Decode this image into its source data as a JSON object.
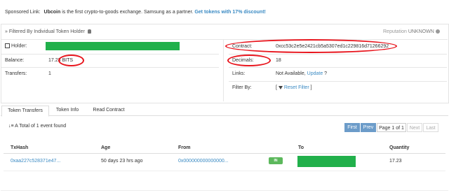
{
  "sponsor": {
    "label": "Sponsored Link:",
    "brand": "Ubcoin",
    "text": "is the first crypto-to-goods exchange. Samsung as a partner.",
    "link": "Get tokens with 17% discount!"
  },
  "panel": {
    "title": "» Filtered By Individual Token Holder",
    "reputation_label": "Reputation",
    "reputation_value": "UNKNOWN",
    "holder_label": "Holder:",
    "balance_label": "Balance:",
    "balance_value": "17.23 BITS",
    "transfers_label": "Transfers:",
    "transfers_value": "1",
    "contract_label": "Contract:",
    "contract_value": "0xcc53c2e5e2421cb5a5307ed1c229816d71266292",
    "decimals_label": "Decimals:",
    "decimals_value": "18",
    "links_label": "Links:",
    "links_value": "Not Available,",
    "links_update": "Update",
    "links_q": "?",
    "filter_label": "Filter By:",
    "filter_open": "[",
    "filter_reset": "Reset Filter",
    "filter_close": "]"
  },
  "tabs": [
    "Token Transfers",
    "Token Info",
    "Read Contract"
  ],
  "events": {
    "summary": "A Total of 1 event found"
  },
  "pagination": {
    "first": "First",
    "prev": "Prev",
    "page": "Page 1 of 1",
    "next": "Next",
    "last": "Last"
  },
  "table": {
    "headers": [
      "TxHash",
      "Age",
      "From",
      "To",
      "Quantity"
    ],
    "rows": [
      {
        "txhash": "0xaa227c528371e47...",
        "age": "50 days 23 hrs ago",
        "from": "0x000000000000000...",
        "direction": "IN",
        "quantity": "17.23"
      }
    ]
  },
  "colors": {
    "accent": "#3a8ac3",
    "redaction": "#21b04b",
    "annotation": "#e8141c",
    "pager_active": "#6c9cc9"
  }
}
